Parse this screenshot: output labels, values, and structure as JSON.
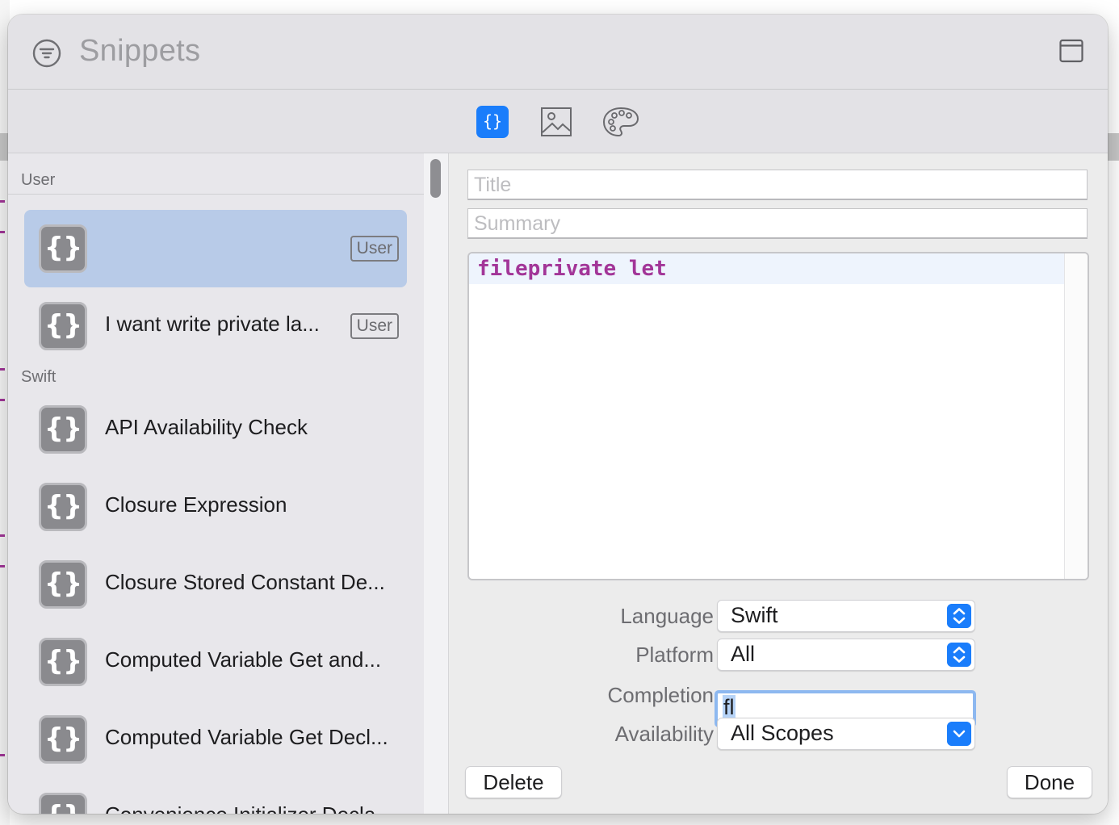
{
  "window": {
    "title": "Snippets"
  },
  "toolbar": {
    "icons": [
      "code-snippet-icon",
      "image-icon",
      "palette-icon"
    ],
    "code_glyph": "{}"
  },
  "sidebar": {
    "sections": [
      {
        "header": "User",
        "items": [
          {
            "label": "",
            "badge": "User",
            "selected": true,
            "icon_glyph": "{}"
          },
          {
            "label": "I want write private la...",
            "badge": "User",
            "selected": false,
            "icon_glyph": "{}"
          }
        ]
      },
      {
        "header": "Swift",
        "items": [
          {
            "label": "API Availability Check",
            "icon_glyph": "{}"
          },
          {
            "label": "Closure Expression",
            "icon_glyph": "{}"
          },
          {
            "label": "Closure Stored Constant De...",
            "icon_glyph": "{}"
          },
          {
            "label": "Computed Variable Get and...",
            "icon_glyph": "{}"
          },
          {
            "label": "Computed Variable Get Decl...",
            "icon_glyph": "{}"
          },
          {
            "label": "Convenience Initializer Decla...",
            "icon_glyph": "{}"
          }
        ]
      }
    ]
  },
  "detail": {
    "title_placeholder": "Title",
    "summary_placeholder": "Summary",
    "code": "fileprivate let",
    "form": {
      "language_label": "Language",
      "language_value": "Swift",
      "platform_label": "Platform",
      "platform_value": "All",
      "completion_label": "Completion",
      "completion_value": "fl",
      "availability_label": "Availability",
      "availability_value": "All Scopes"
    },
    "buttons": {
      "delete": "Delete",
      "done": "Done"
    }
  },
  "colors": {
    "accent": "#1a7dfb",
    "selection": "#b8cbe8",
    "keyword": "#a23598"
  }
}
